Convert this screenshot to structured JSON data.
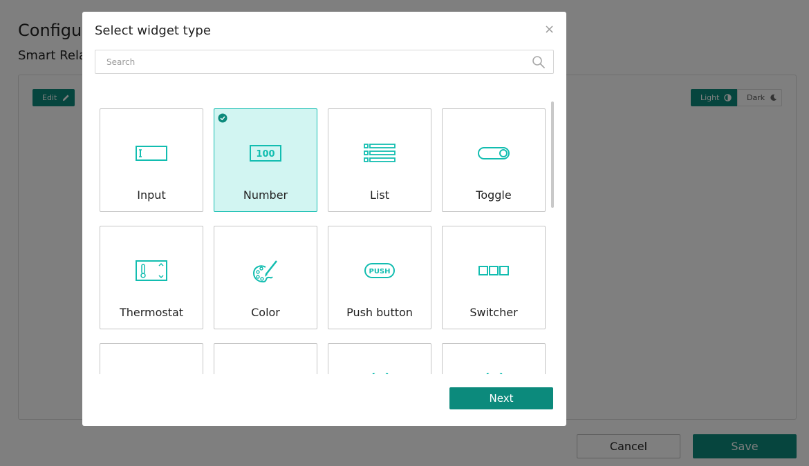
{
  "background": {
    "page_title": "Configur",
    "subtitle": "Smart Rela",
    "edit_label": "Edit",
    "theme_light_label": "Light",
    "theme_dark_label": "Dark",
    "cancel_label": "Cancel",
    "save_label": "Save"
  },
  "modal": {
    "title": "Select widget type",
    "close_glyph": "×",
    "search_placeholder": "Search",
    "next_label": "Next",
    "selected_widget": "Number",
    "widgets": [
      {
        "label": "Input",
        "icon": "input-icon",
        "selected": false
      },
      {
        "label": "Number",
        "icon": "number-100-icon",
        "selected": true
      },
      {
        "label": "List",
        "icon": "list-icon",
        "selected": false
      },
      {
        "label": "Toggle",
        "icon": "toggle-icon",
        "selected": false
      },
      {
        "label": "Thermostat",
        "icon": "thermostat-icon",
        "selected": false
      },
      {
        "label": "Color",
        "icon": "palette-icon",
        "selected": false
      },
      {
        "label": "Push button",
        "icon": "push-button-icon",
        "selected": false
      },
      {
        "label": "Switcher",
        "icon": "switcher-icon",
        "selected": false
      }
    ]
  },
  "colors": {
    "accent": "#0c8a7c",
    "icon_teal": "#12bdb0",
    "selected_bg": "#d2f5f2"
  }
}
